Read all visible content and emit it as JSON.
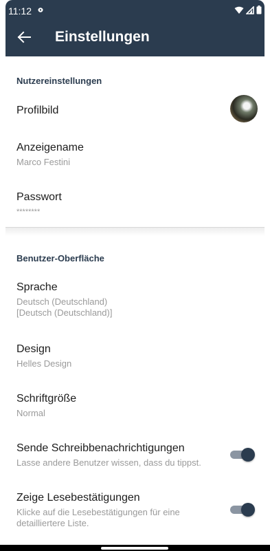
{
  "status_bar": {
    "time": "11:12",
    "icons": [
      "bug-icon",
      "wifi-icon",
      "signal-icon",
      "battery-icon"
    ]
  },
  "app_bar": {
    "title": "Einstellungen",
    "back_icon": "arrow-back-icon"
  },
  "sections": {
    "user": {
      "title": "Nutzereinstellungen",
      "profile_picture_label": "Profilbild",
      "display_name_label": "Anzeigename",
      "display_name_value": "Marco Festini",
      "password_label": "Passwort",
      "password_value": "********"
    },
    "ui": {
      "title": "Benutzer-Oberfläche",
      "language_label": "Sprache",
      "language_value_line1": "Deutsch (Deutschland)",
      "language_value_line2": "[Deutsch (Deutschland)]",
      "design_label": "Design",
      "design_value": "Helles Design",
      "font_size_label": "Schriftgröße",
      "font_size_value": "Normal",
      "typing_label": "Sende Schreibbenachrichtigungen",
      "typing_desc": "Lasse andere Benutzer wissen, dass du tippst.",
      "typing_enabled": true,
      "receipts_label": "Zeige Lesebestätigungen",
      "receipts_desc": "Klicke auf die Lesebestätigungen für eine detailliertere Liste.",
      "receipts_enabled": true
    }
  },
  "colors": {
    "primary": "#2b3c4f",
    "toggle_track": "#8b95a2",
    "secondary_text": "#9a9a9a"
  }
}
